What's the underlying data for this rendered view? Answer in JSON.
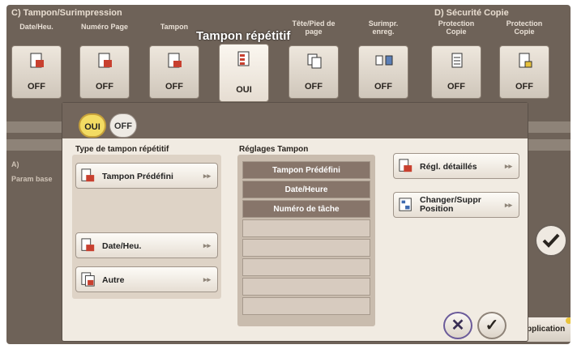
{
  "sections": {
    "c": "C)  Tampon/Surimpression",
    "d": "D)  Sécurité Copie"
  },
  "top_title": "Tampon répétitif",
  "tiles": [
    {
      "label": "Date/Heu.",
      "value": "OFF"
    },
    {
      "label": "Numéro Page",
      "value": "OFF"
    },
    {
      "label": "Tampon",
      "value": "OFF"
    },
    {
      "label": "",
      "value": "OUI"
    },
    {
      "label": "Tête/Pied de page",
      "value": "OFF"
    },
    {
      "label": "Surimpr. enreg.",
      "value": "OFF"
    },
    {
      "label": "Protection Copie",
      "value": "OFF"
    },
    {
      "label": "Protection Copie",
      "value": "OFF"
    }
  ],
  "left_side": {
    "a": "A)",
    "text": "Param base"
  },
  "application_label": "pplication",
  "dialog": {
    "on_label": "OUI",
    "off_label": "OFF",
    "type_title": "Type de tampon répétitif",
    "settings_title": "Réglages Tampon",
    "buttons": {
      "predefined": "Tampon Prédéfini",
      "date_time": "Date/Heu.",
      "other": "Autre",
      "detailed": "Régl. détaillés",
      "change_position_1": "Changer/Suppr",
      "change_position_2": "Position"
    },
    "settings_rows": [
      "Tampon Prédéfini",
      "Date/Heure",
      "Numéro de tâche",
      "",
      "",
      "",
      "",
      "",
      ""
    ],
    "arrow": "▸▸",
    "cancel_symbol": "✕",
    "ok_symbol": "✓"
  }
}
